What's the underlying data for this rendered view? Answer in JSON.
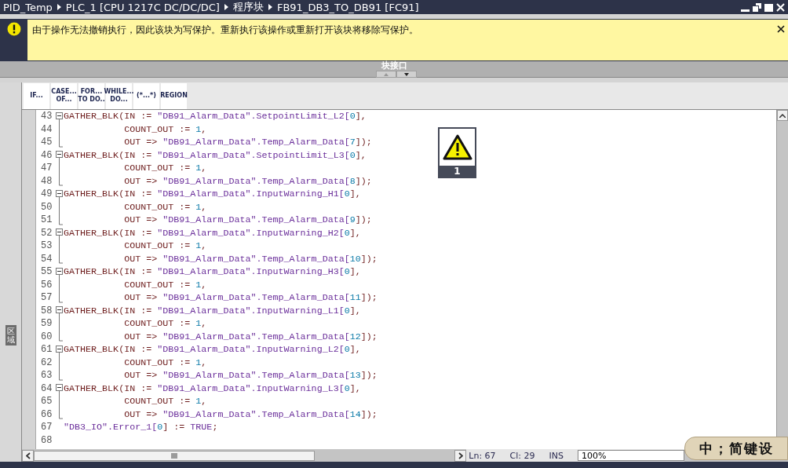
{
  "title_bar": {
    "breadcrumb": [
      "PID_Temp",
      "PLC_1 [CPU 1217C DC/DC/DC]",
      "程序块",
      "FB91_DB3_TO_DB91 [FC91]"
    ]
  },
  "info_bar": {
    "message": "由于操作无法撤销执行，因此该块为写保护。重新执行该操作或重新打开该块将移除写保护。"
  },
  "panel_header": {
    "label": "块接口"
  },
  "side_tab": {
    "label": "区域"
  },
  "toolbar": {
    "buttons": [
      [
        "IF..."
      ],
      [
        "CASE...",
        "OF..."
      ],
      [
        "FOR...",
        "TO DO.."
      ],
      [
        "WHILE...",
        "DO..."
      ],
      [
        "(*...*)"
      ],
      [
        "REGION"
      ]
    ]
  },
  "warning_badge": {
    "count": "1"
  },
  "code_lines": [
    {
      "number": "43",
      "fold": {
        "start": true,
        "end": false
      },
      "code": "GATHER_BLK(IN := \"DB91_Alarm_Data\".SetpointLimit_L2[0],"
    },
    {
      "number": "44",
      "fold": {
        "start": false,
        "end": false
      },
      "code": "           COUNT_OUT := 1,"
    },
    {
      "number": "45",
      "fold": {
        "start": false,
        "end": true
      },
      "code": "           OUT => \"DB91_Alarm_Data\".Temp_Alarm_Data[7]);"
    },
    {
      "number": "46",
      "fold": {
        "start": true,
        "end": false
      },
      "code": "GATHER_BLK(IN := \"DB91_Alarm_Data\".SetpointLimit_L3[0],"
    },
    {
      "number": "47",
      "fold": {
        "start": false,
        "end": false
      },
      "code": "           COUNT_OUT := 1,"
    },
    {
      "number": "48",
      "fold": {
        "start": false,
        "end": true
      },
      "code": "           OUT => \"DB91_Alarm_Data\".Temp_Alarm_Data[8]);"
    },
    {
      "number": "49",
      "fold": {
        "start": true,
        "end": false
      },
      "code": "GATHER_BLK(IN := \"DB91_Alarm_Data\".InputWarning_H1[0],"
    },
    {
      "number": "50",
      "fold": {
        "start": false,
        "end": false
      },
      "code": "           COUNT_OUT := 1,"
    },
    {
      "number": "51",
      "fold": {
        "start": false,
        "end": true
      },
      "code": "           OUT => \"DB91_Alarm_Data\".Temp_Alarm_Data[9]);"
    },
    {
      "number": "52",
      "fold": {
        "start": true,
        "end": false
      },
      "code": "GATHER_BLK(IN := \"DB91_Alarm_Data\".InputWarning_H2[0],"
    },
    {
      "number": "53",
      "fold": {
        "start": false,
        "end": false
      },
      "code": "           COUNT_OUT := 1,"
    },
    {
      "number": "54",
      "fold": {
        "start": false,
        "end": true
      },
      "code": "           OUT => \"DB91_Alarm_Data\".Temp_Alarm_Data[10]);"
    },
    {
      "number": "55",
      "fold": {
        "start": true,
        "end": false
      },
      "code": "GATHER_BLK(IN := \"DB91_Alarm_Data\".InputWarning_H3[0],"
    },
    {
      "number": "56",
      "fold": {
        "start": false,
        "end": false
      },
      "code": "           COUNT_OUT := 1,"
    },
    {
      "number": "57",
      "fold": {
        "start": false,
        "end": true
      },
      "code": "           OUT => \"DB91_Alarm_Data\".Temp_Alarm_Data[11]);"
    },
    {
      "number": "58",
      "fold": {
        "start": true,
        "end": false
      },
      "code": "GATHER_BLK(IN := \"DB91_Alarm_Data\".InputWarning_L1[0],"
    },
    {
      "number": "59",
      "fold": {
        "start": false,
        "end": false
      },
      "code": "           COUNT_OUT := 1,"
    },
    {
      "number": "60",
      "fold": {
        "start": false,
        "end": true
      },
      "code": "           OUT => \"DB91_Alarm_Data\".Temp_Alarm_Data[12]);"
    },
    {
      "number": "61",
      "fold": {
        "start": true,
        "end": false
      },
      "code": "GATHER_BLK(IN := \"DB91_Alarm_Data\".InputWarning_L2[0],"
    },
    {
      "number": "62",
      "fold": {
        "start": false,
        "end": false
      },
      "code": "           COUNT_OUT := 1,"
    },
    {
      "number": "63",
      "fold": {
        "start": false,
        "end": true
      },
      "code": "           OUT => \"DB91_Alarm_Data\".Temp_Alarm_Data[13]);"
    },
    {
      "number": "64",
      "fold": {
        "start": true,
        "end": false
      },
      "code": "GATHER_BLK(IN := \"DB91_Alarm_Data\".InputWarning_L3[0],"
    },
    {
      "number": "65",
      "fold": {
        "start": false,
        "end": false
      },
      "code": "           COUNT_OUT := 1,"
    },
    {
      "number": "66",
      "fold": {
        "start": false,
        "end": true
      },
      "code": "           OUT => \"DB91_Alarm_Data\".Temp_Alarm_Data[14]);"
    },
    {
      "number": "67",
      "code": "\"DB3_IO\".Error_1[0] := TRUE;"
    },
    {
      "number": "68"
    }
  ],
  "status_bar": {
    "line": "Ln: 67",
    "column": "Cl: 29",
    "mode": "INS",
    "zoom": "100%"
  },
  "ime_bar": {
    "text": "中；简键设"
  }
}
